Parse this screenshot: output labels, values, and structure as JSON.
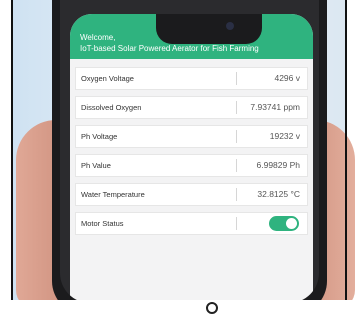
{
  "header": {
    "welcome": "Welcome,",
    "title": "IoT-based Solar Powered Aerator for Fish Farming"
  },
  "readings": [
    {
      "label": "Oxygen Voltage",
      "value": "4296 v"
    },
    {
      "label": "Dissolved Oxygen",
      "value": "7.93741 ppm"
    },
    {
      "label": "Ph Voltage",
      "value": "19232 v"
    },
    {
      "label": "Ph Value",
      "value": "6.99829 Ph"
    },
    {
      "label": "Water Temperature",
      "value": "32.8125 °C"
    }
  ],
  "motor": {
    "label": "Motor Status",
    "state": "on"
  },
  "colors": {
    "accent": "#2fb37f",
    "screen_bg": "#f3f3f4"
  }
}
